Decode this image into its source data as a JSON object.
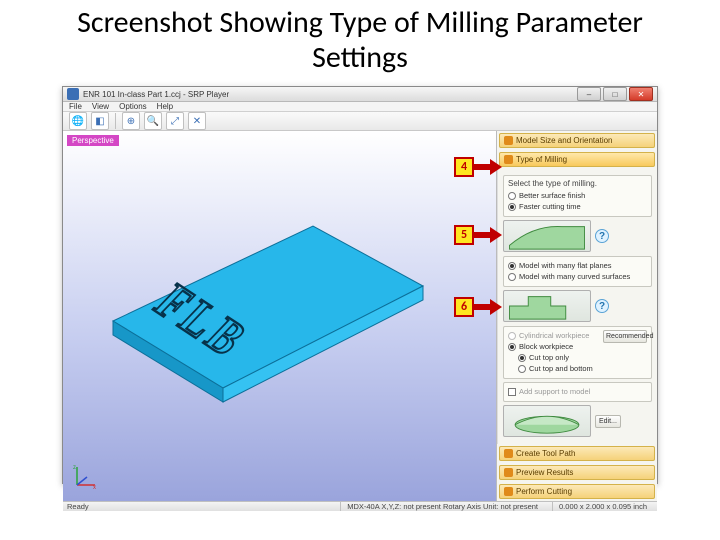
{
  "slide": {
    "title": "Screenshot Showing Type of Milling Parameter Settings"
  },
  "window": {
    "title": "ENR 101 In-class Part 1.ccj - SRP Player",
    "title_right": "",
    "menus": [
      "File",
      "View",
      "Options",
      "Help"
    ],
    "minimize": "–",
    "maximize": "□",
    "close": "✕"
  },
  "toolbar_icons": [
    "globe-icon",
    "cube-icon",
    "zoom-in-icon",
    "zoom-fit-icon",
    "expand-icon",
    "shrink-icon"
  ],
  "viewport": {
    "label": "Perspective",
    "engraving": "FLB"
  },
  "panel": {
    "headers": {
      "size": "Model Size and Orientation",
      "milling": "Type of Milling",
      "toolpath": "Create Tool Path",
      "preview": "Preview Results",
      "perform": "Perform Cutting"
    },
    "group1": {
      "title": "Select the type of milling.",
      "opt_a": "Better surface finish",
      "opt_b": "Faster cutting time"
    },
    "group2": {
      "opt_a": "Model with many flat planes",
      "opt_b": "Model with many curved surfaces"
    },
    "group3": {
      "opt_a": "Cylindrical workpiece",
      "opt_b": "Block workpiece",
      "sub_a": "Cut top only",
      "sub_b": "Cut top and bottom",
      "btn_recom": "Recommended"
    },
    "group4": {
      "check": "Add support to model",
      "btn_edit": "Edit..."
    }
  },
  "callouts": {
    "c4": "4",
    "c5": "5",
    "c6": "6"
  },
  "status": {
    "ready": "Ready",
    "mid": "MDX-40A   X,Y,Z: not present   Rotary Axis Unit: not present",
    "right": "0.000 x 2.000 x 0.095   inch"
  }
}
